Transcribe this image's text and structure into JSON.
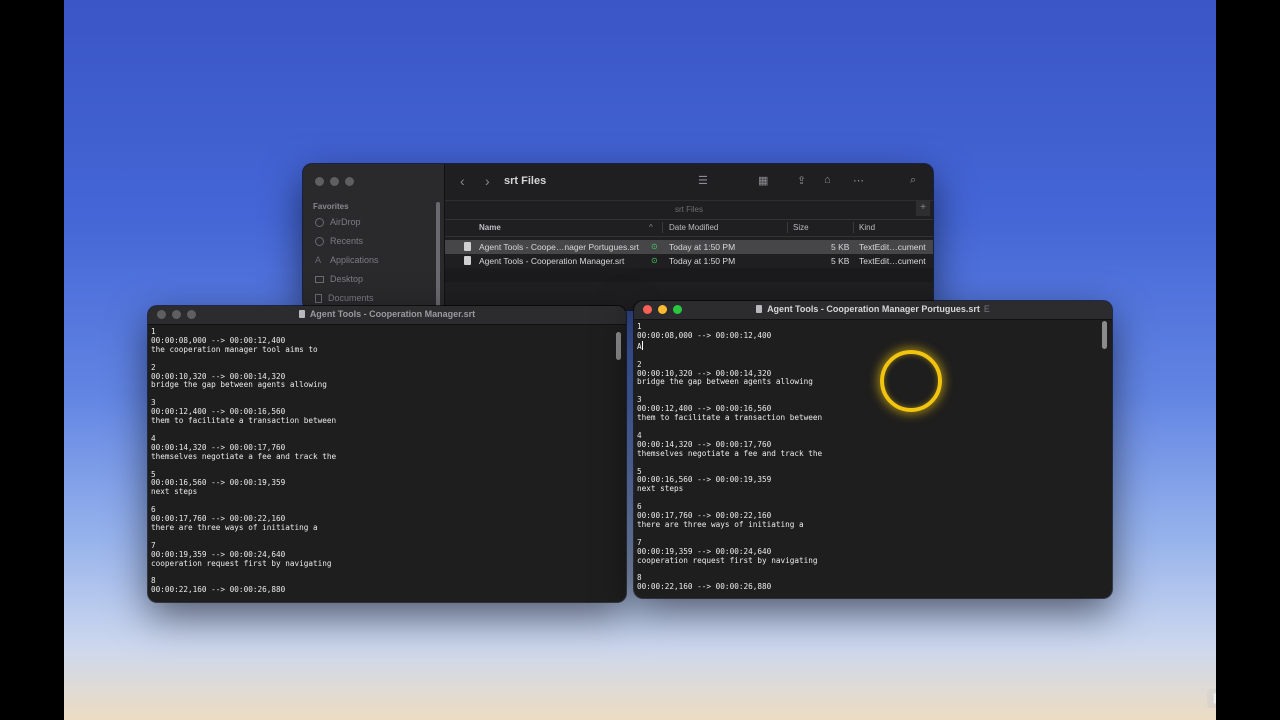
{
  "finder": {
    "title": "srt Files",
    "path_title": "srt Files",
    "favorites_label": "Favorites",
    "sidebar_items": [
      {
        "label": "AirDrop",
        "icon": "airdrop-icon"
      },
      {
        "label": "Recents",
        "icon": "clock-icon"
      },
      {
        "label": "Applications",
        "icon": "applications-icon"
      },
      {
        "label": "Desktop",
        "icon": "desktop-icon"
      },
      {
        "label": "Documents",
        "icon": "document-icon"
      }
    ],
    "columns": {
      "name": "Name",
      "date": "Date Modified",
      "size": "Size",
      "kind": "Kind"
    },
    "files": [
      {
        "name": "Agent Tools - Coope…nager Portugues.srt",
        "date": "Today at 1:50 PM",
        "size": "5 KB",
        "kind": "TextEdit…cument",
        "selected": true
      },
      {
        "name": "Agent Tools - Cooperation Manager.srt",
        "date": "Today at 1:50 PM",
        "size": "5 KB",
        "kind": "TextEdit…cument",
        "selected": false
      }
    ],
    "icons": {
      "back": "‹",
      "forward": "›",
      "list_view": "☰",
      "grid_view": "▦",
      "share": "⇪",
      "tag": "⌂",
      "more": "⋯",
      "search": "⌕",
      "plus": "+"
    }
  },
  "editor_left": {
    "title": "Agent Tools - Cooperation Manager.srt",
    "lines": [
      "1",
      "00:00:08,000 --> 00:00:12,400",
      "the cooperation manager tool aims to",
      "",
      "2",
      "00:00:10,320 --> 00:00:14,320",
      "bridge the gap between agents allowing",
      "",
      "3",
      "00:00:12,400 --> 00:00:16,560",
      "them to facilitate a transaction between",
      "",
      "4",
      "00:00:14,320 --> 00:00:17,760",
      "themselves negotiate a fee and track the",
      "",
      "5",
      "00:00:16,560 --> 00:00:19,359",
      "next steps",
      "",
      "6",
      "00:00:17,760 --> 00:00:22,160",
      "there are three ways of initiating a",
      "",
      "7",
      "00:00:19,359 --> 00:00:24,640",
      "cooperation request first by navigating",
      "",
      "8",
      "00:00:22,160 --> 00:00:26,880"
    ]
  },
  "editor_right": {
    "title": "Agent Tools - Cooperation Manager Portugues.srt",
    "edited_marker": "E",
    "lines": [
      "1",
      "00:00:08,000 --> 00:00:12,400",
      "A",
      "",
      "2",
      "00:00:10,320 --> 00:00:14,320",
      "bridge the gap between agents allowing",
      "",
      "3",
      "00:00:12,400 --> 00:00:16,560",
      "them to facilitate a transaction between",
      "",
      "4",
      "00:00:14,320 --> 00:00:17,760",
      "themselves negotiate a fee and track the",
      "",
      "5",
      "00:00:16,560 --> 00:00:19,359",
      "next steps",
      "",
      "6",
      "00:00:17,760 --> 00:00:22,160",
      "there are three ways of initiating a",
      "",
      "7",
      "00:00:19,359 --> 00:00:24,640",
      "cooperation request first by navigating",
      "",
      "8",
      "00:00:22,160 --> 00:00:26,880"
    ]
  },
  "recording": {
    "pause_icon": "❚❚",
    "stop_icon": "◙"
  },
  "colors": {
    "accent_selection": "#464649",
    "click_ring": "#f1c40f",
    "synced": "#3ecf5a"
  }
}
